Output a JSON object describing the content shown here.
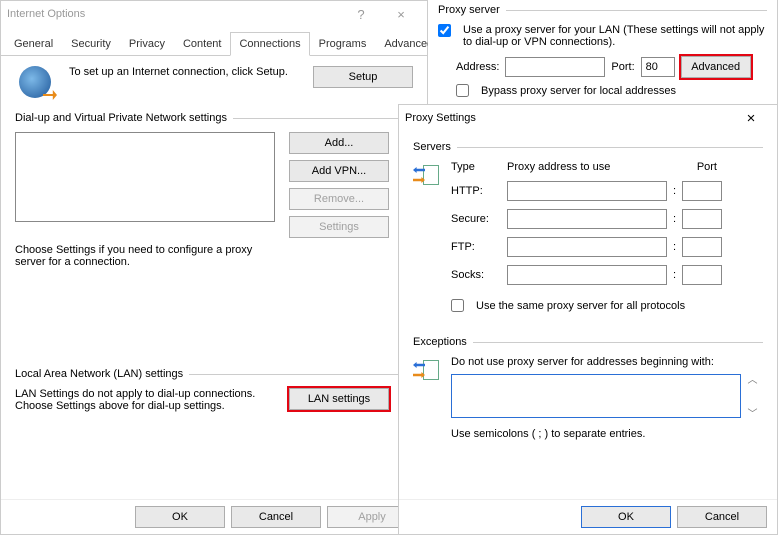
{
  "io": {
    "title": "Internet Options",
    "help": "?",
    "close": "×",
    "tabs": [
      "General",
      "Security",
      "Privacy",
      "Content",
      "Connections",
      "Programs",
      "Advanced"
    ],
    "activeTab": 4,
    "setupText": "To set up an Internet connection, click Setup.",
    "setupBtn": "Setup",
    "dialGroup": "Dial-up and Virtual Private Network settings",
    "addBtn": "Add...",
    "addVpnBtn": "Add VPN...",
    "removeBtn": "Remove...",
    "settingsBtn": "Settings",
    "chooseText": "Choose Settings if you need to configure a proxy server for a connection.",
    "lanGroup": "Local Area Network (LAN) settings",
    "lanText": "LAN Settings do not apply to dial-up connections. Choose Settings above for dial-up settings.",
    "lanBtn": "LAN settings",
    "ok": "OK",
    "cancel": "Cancel",
    "apply": "Apply"
  },
  "lan": {
    "group": "Proxy server",
    "useProxy": "Use a proxy server for your LAN (These settings will not apply to dial-up or VPN connections).",
    "useProxyChecked": true,
    "addressLabel": "Address:",
    "addressValue": "",
    "portLabel": "Port:",
    "portValue": "80",
    "advancedBtn": "Advanced",
    "bypass": "Bypass proxy server for local addresses",
    "bypassChecked": false
  },
  "ps": {
    "title": "Proxy Settings",
    "close": "×",
    "servers": "Servers",
    "type": "Type",
    "addr": "Proxy address to use",
    "port": "Port",
    "rows": [
      {
        "label": "HTTP:",
        "addr": "",
        "port": ""
      },
      {
        "label": "Secure:",
        "addr": "",
        "port": ""
      },
      {
        "label": "FTP:",
        "addr": "",
        "port": ""
      },
      {
        "label": "Socks:",
        "addr": "",
        "port": ""
      }
    ],
    "same": "Use the same proxy server for all protocols",
    "sameChecked": false,
    "exceptions": "Exceptions",
    "exText": "Do not use proxy server for addresses beginning with:",
    "exValue": "",
    "semiText": "Use semicolons ( ; ) to separate entries.",
    "ok": "OK",
    "cancel": "Cancel"
  }
}
